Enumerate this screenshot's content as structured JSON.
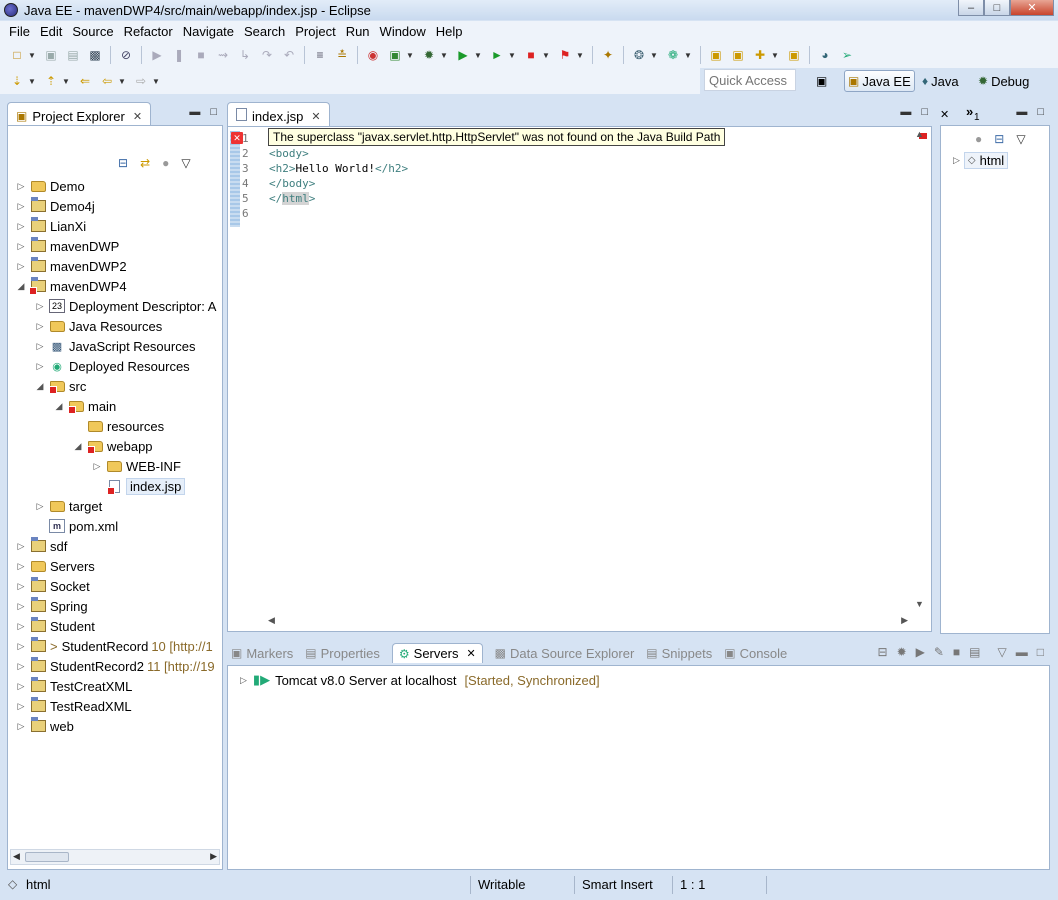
{
  "window": {
    "title": "Java EE - mavenDWP4/src/main/webapp/index.jsp - Eclipse"
  },
  "menu": [
    "File",
    "Edit",
    "Source",
    "Refactor",
    "Navigate",
    "Search",
    "Project",
    "Run",
    "Window",
    "Help"
  ],
  "toolbar": {
    "quick_access": "Quick Access",
    "perspectives": [
      "Java EE",
      "Java",
      "Debug"
    ]
  },
  "project_explorer": {
    "tab_label": "Project Explorer",
    "items": [
      {
        "label": "Demo"
      },
      {
        "label": "Demo4j"
      },
      {
        "label": "LianXi"
      },
      {
        "label": "mavenDWP"
      },
      {
        "label": "mavenDWP2"
      },
      {
        "label": "mavenDWP4"
      },
      {
        "label": "Deployment Descriptor: A"
      },
      {
        "label": "Java Resources"
      },
      {
        "label": "JavaScript Resources"
      },
      {
        "label": "Deployed Resources"
      },
      {
        "label": "src"
      },
      {
        "label": "main"
      },
      {
        "label": "resources"
      },
      {
        "label": "webapp"
      },
      {
        "label": "WEB-INF"
      },
      {
        "label": "index.jsp"
      },
      {
        "label": "target"
      },
      {
        "label": "pom.xml"
      },
      {
        "label": "sdf"
      },
      {
        "label": "Servers"
      },
      {
        "label": "Socket"
      },
      {
        "label": "Spring"
      },
      {
        "label": "Student"
      },
      {
        "label": "StudentRecord",
        "prefix": ">",
        "decoration": "10 [http://1"
      },
      {
        "label": "StudentRecord2",
        "decoration": "11 [http://19"
      },
      {
        "label": "TestCreatXML"
      },
      {
        "label": "TestReadXML"
      },
      {
        "label": "web"
      }
    ]
  },
  "editor": {
    "tab_label": "index.jsp",
    "tooltip": "The superclass \"javax.servlet.http.HttpServlet\" was not found on the Java Build Path",
    "line_numbers": [
      "1",
      "2",
      "3",
      "4",
      "5",
      "6"
    ],
    "lines": [
      {
        "tag1": "",
        "text": "",
        "tag2": ""
      },
      {
        "tag1": "<body>",
        "text": "",
        "tag2": ""
      },
      {
        "tag1": "<h2>",
        "text": "Hello World!",
        "tag2": "</h2>"
      },
      {
        "tag1": "</body>",
        "text": "",
        "tag2": ""
      },
      {
        "tag1": "</",
        "text": "html",
        "tag2": ">"
      },
      {
        "tag1": "",
        "text": "",
        "tag2": ""
      }
    ]
  },
  "outline": {
    "tab_label": "1",
    "item": "html"
  },
  "bottom_panel": {
    "tabs": [
      "Markers",
      "Properties",
      "Servers",
      "Data Source Explorer",
      "Snippets",
      "Console"
    ],
    "active_tab": "Servers",
    "server": "Tomcat v8.0 Server at localhost",
    "server_state": "[Started, Synchronized]"
  },
  "status_bar": {
    "selection": "html",
    "mode": "Writable",
    "insert": "Smart Insert",
    "position": "1 : 1"
  }
}
